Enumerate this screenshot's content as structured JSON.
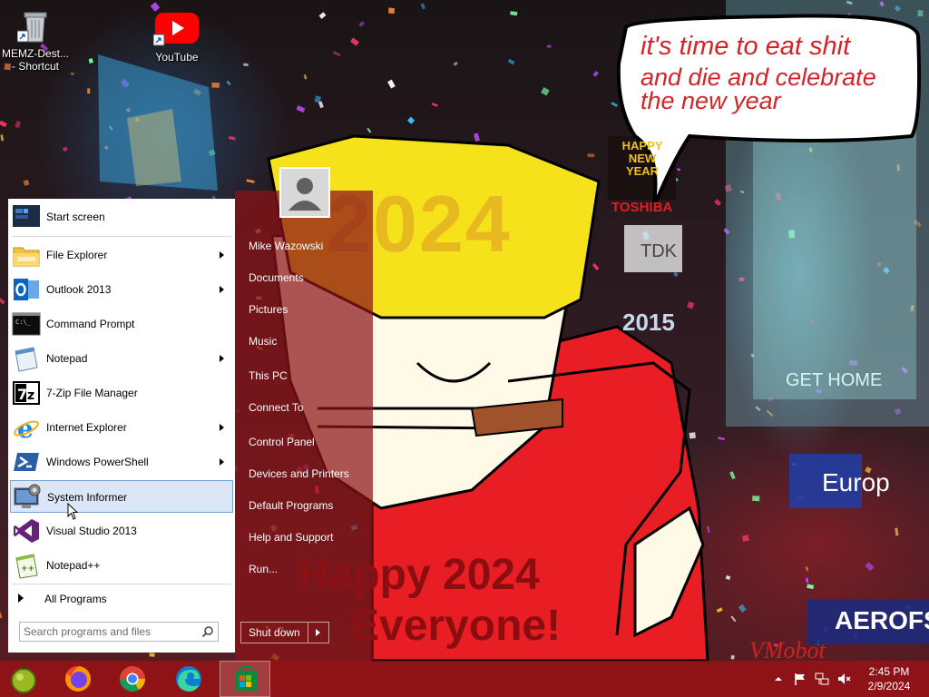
{
  "desktop": {
    "icons": [
      {
        "label": "MEMZ-Dest... - Shortcut",
        "icon": "recycle-bin-icon"
      },
      {
        "label": "YouTube",
        "icon": "youtube-icon"
      }
    ],
    "wallpaper": {
      "bubble_line1": "it's time to eat shit",
      "bubble_line2": "and die and celebrate",
      "bubble_line3": "the new year",
      "headband": "2024",
      "happy_line1": "Happy 2024",
      "happy_line2": "Everyone!",
      "signature": "VMobot",
      "sign_tdk": "TDK",
      "sign_2015": "2015",
      "sign_gethome": "GET HOME",
      "sign_europe": "Europ",
      "sign_aerofs": "AEROFS",
      "sign_happy_new_year": "HAPPY NEW YEAR",
      "sign_toshiba": "TOSHIBA"
    }
  },
  "start_menu": {
    "programs": [
      {
        "label": "Start screen",
        "icon": "start-screen-icon",
        "submenu": false
      },
      {
        "label": "File Explorer",
        "icon": "file-explorer-icon",
        "submenu": true
      },
      {
        "label": "Outlook 2013",
        "icon": "outlook-icon",
        "submenu": true
      },
      {
        "label": "Command Prompt",
        "icon": "command-prompt-icon",
        "submenu": false
      },
      {
        "label": "Notepad",
        "icon": "notepad-icon",
        "submenu": true
      },
      {
        "label": "7-Zip File Manager",
        "icon": "7zip-icon",
        "submenu": false
      },
      {
        "label": "Internet Explorer",
        "icon": "internet-explorer-icon",
        "submenu": true
      },
      {
        "label": "Windows PowerShell",
        "icon": "powershell-icon",
        "submenu": true
      },
      {
        "label": "System Informer",
        "icon": "system-informer-icon",
        "submenu": false,
        "highlighted": true
      },
      {
        "label": "Visual Studio 2013",
        "icon": "visual-studio-icon",
        "submenu": false
      },
      {
        "label": "Notepad++",
        "icon": "notepadpp-icon",
        "submenu": false
      }
    ],
    "all_programs": "All Programs",
    "search_placeholder": "Search programs and files",
    "user_name": "Mike Wazowski",
    "places": [
      "Documents",
      "Pictures",
      "Music",
      "This PC",
      "Connect To",
      "Control Panel",
      "Devices and Printers",
      "Default Programs",
      "Help and Support",
      "Run..."
    ],
    "shutdown_label": "Shut down",
    "colors": {
      "accent": "#8c1418",
      "highlight": "#dbe7f7"
    }
  },
  "taskbar": {
    "pinned": [
      {
        "icon": "start-orb-icon"
      },
      {
        "icon": "firefox-icon"
      },
      {
        "icon": "chrome-icon"
      },
      {
        "icon": "edge-icon"
      },
      {
        "icon": "store-icon",
        "active": true
      }
    ],
    "tray": [
      "chevron-up-icon",
      "flag-icon",
      "network-icon",
      "volume-muted-icon"
    ],
    "time": "2:45 PM",
    "date": "2/9/2024"
  }
}
